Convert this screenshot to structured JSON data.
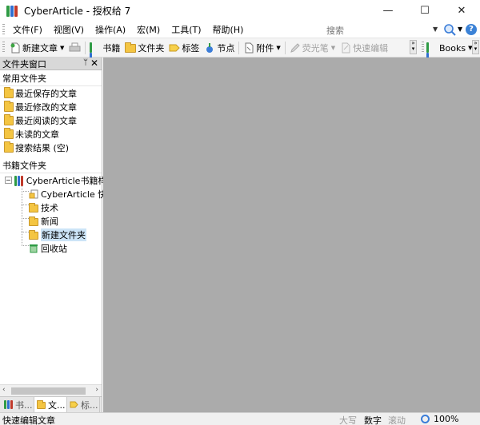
{
  "window": {
    "title": "CyberArticle - 授权给 7",
    "controls": {
      "minimize": "—",
      "maximize": "☐",
      "close": "✕"
    }
  },
  "menu": {
    "items": [
      "文件(F)",
      "视图(V)",
      "操作(A)",
      "宏(M)",
      "工具(T)",
      "帮助(H)"
    ],
    "search_placeholder": "搜索"
  },
  "toolbar": {
    "new_article": "新建文章",
    "books": "书籍",
    "folder": "文件夹",
    "tags": "标签",
    "nodes": "节点",
    "attachment": "附件",
    "highlighter": "荧光笔",
    "quick_edit": "快速编辑",
    "books_menu": "Books"
  },
  "left_panel": {
    "title": "文件夹窗口",
    "pin_glyph": "ᛘ",
    "close_glyph": "✕",
    "common_title": "常用文件夹",
    "common_items": [
      "最近保存的文章",
      "最近修改的文章",
      "最近阅读的文章",
      "未读的文章",
      "搜索结果 (空)"
    ],
    "books_title": "书籍文件夹",
    "tree": {
      "root": "CyberArticle书籍样",
      "children": [
        "CyberArticle 快",
        "技术",
        "新闻",
        "新建文件夹",
        "回收站"
      ]
    },
    "bottom_tabs": [
      "书...",
      "文...",
      "标..."
    ]
  },
  "statusbar": {
    "left_text": "快速编辑文章",
    "caps": "大写",
    "num": "数字",
    "scroll": "滚动",
    "zoom": "100%"
  },
  "colors": {
    "main_bg": "#ababab",
    "selection": "#cce4f7",
    "folder": "#f4c542"
  }
}
